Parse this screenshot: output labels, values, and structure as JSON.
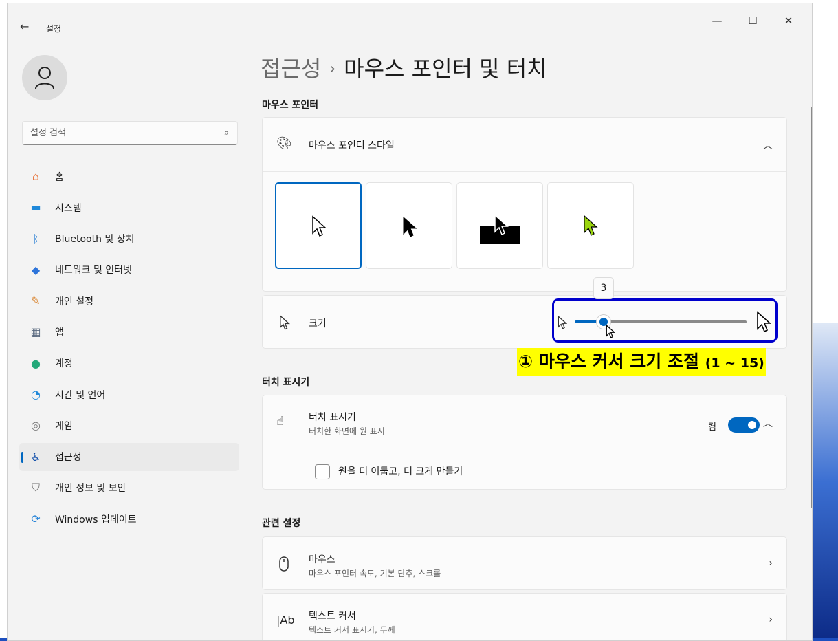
{
  "window": {
    "app_title": "설정",
    "back_glyph": "←",
    "minimize_glyph": "—",
    "maximize_glyph": "☐",
    "close_glyph": "✕"
  },
  "search": {
    "placeholder": "설정 검색",
    "icon": "search-icon"
  },
  "sidebar": {
    "items": [
      {
        "label": "홈",
        "icon": "home-icon",
        "glyph": "⌂",
        "color": "#e8743b"
      },
      {
        "label": "시스템",
        "icon": "system-icon",
        "glyph": "▬",
        "color": "#1f88d9"
      },
      {
        "label": "Bluetooth 및 장치",
        "icon": "bluetooth-icon",
        "glyph": "ᛒ",
        "color": "#1573d1"
      },
      {
        "label": "네트워크 및 인터넷",
        "icon": "wifi-icon",
        "glyph": "◆",
        "color": "#2d74da"
      },
      {
        "label": "개인 설정",
        "icon": "brush-icon",
        "glyph": "✎",
        "color": "#d9822b"
      },
      {
        "label": "앱",
        "icon": "apps-icon",
        "glyph": "▦",
        "color": "#5a6a80"
      },
      {
        "label": "계정",
        "icon": "account-icon",
        "glyph": "●",
        "color": "#23a879"
      },
      {
        "label": "시간 및 언어",
        "icon": "time-language-icon",
        "glyph": "◔",
        "color": "#1f88d9"
      },
      {
        "label": "게임",
        "icon": "gamepad-icon",
        "glyph": "◎",
        "color": "#7a7a7a"
      },
      {
        "label": "접근성",
        "icon": "accessibility-icon",
        "glyph": "♿",
        "color": "#0a4aa8",
        "active": true
      },
      {
        "label": "개인 정보 및 보안",
        "icon": "shield-icon",
        "glyph": "⛉",
        "color": "#6b6b6b"
      },
      {
        "label": "Windows 업데이트",
        "icon": "update-icon",
        "glyph": "⟳",
        "color": "#1f7fd6"
      }
    ]
  },
  "breadcrumb": {
    "parent": "접근성",
    "separator": "›",
    "current": "마우스 포인터 및 터치"
  },
  "mouse_pointer": {
    "section_title": "마우스 포인터",
    "style_row": {
      "label": "마우스 포인터 스타일",
      "icon": "palette-icon"
    },
    "styles": [
      "white",
      "black",
      "inverted",
      "custom"
    ],
    "custom_color": "#9bd60d",
    "selected_style": 0,
    "size_row": {
      "label": "크기",
      "icon": "pointer-icon"
    },
    "size_value": "3",
    "size_min": 1,
    "size_max": 15
  },
  "annotation": {
    "main": "① 마우스 커서 크기 조절 ",
    "range": "(1 ~ 15)"
  },
  "touch": {
    "section_title": "터치 표시기",
    "row_label": "터치 표시기",
    "row_sub": "터치한 화면에 원 표시",
    "toggle_label": "켬",
    "toggle_on": true,
    "checkbox_label": "원을 더 어둡고, 더 크게 만들기",
    "checked": false
  },
  "related": {
    "section_title": "관련 설정",
    "items": [
      {
        "label": "마우스",
        "sub": "마우스 포인터 속도, 기본 단추, 스크롤",
        "icon": "mouse-icon"
      },
      {
        "label": "텍스트 커서",
        "sub": "텍스트 커서 표시기, 두께",
        "icon": "text-cursor-icon"
      }
    ]
  },
  "colors": {
    "accent": "#0067c0",
    "annotation_box": "#0000cc",
    "highlight": "#ffff00"
  }
}
